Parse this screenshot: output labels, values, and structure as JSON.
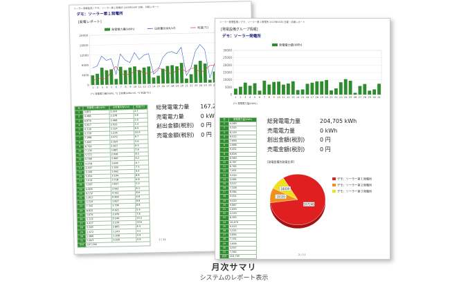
{
  "back": {
    "header_small": "ソーラー発電監視 / デモ：ソーラー第１発電所 2019年04月 日報・月報レポート",
    "title": "デモ：ソーラー第１発電所",
    "report_label": "[発電レポート]",
    "legend": [
      "発電電力量(kWh)",
      "日射量(kWh/㎡)",
      "気温(℃)"
    ],
    "axis_note": "(*1 発電電力量(kWh), *2 日射量(kWh/㎡), *3 気温(℃))",
    "table_headers": [
      "日",
      "発電電力量(kWh)",
      "日射量(kWh/㎡)",
      "気温(℃)"
    ],
    "rows": [
      [
        "1",
        "3,857",
        "2.059",
        "2.7"
      ],
      [
        "2",
        "4,488",
        "2.278",
        "3.8"
      ],
      [
        "3",
        "6,876",
        "3.468",
        "3.9"
      ],
      [
        "4",
        "5,817",
        "2.932",
        "3.4"
      ],
      [
        "5",
        "6,126",
        "3.124",
        "8.4"
      ],
      [
        "6",
        "2,239",
        "1.236",
        "10.9"
      ],
      [
        "7",
        "7,088",
        "3.672",
        "6.7"
      ],
      [
        "8",
        "5,665",
        "2.924",
        "5.6"
      ],
      [
        "9",
        "6,720",
        "2.615",
        "6.4"
      ],
      [
        "10",
        "7,136",
        "3.805",
        "7.6"
      ],
      [
        "11",
        "5,572",
        "2.958",
        "8.5"
      ],
      [
        "12",
        "6,586",
        "3.460",
        "6.2"
      ],
      [
        "13",
        "6,958",
        "3.648",
        "6.7"
      ],
      [
        "14",
        "2,497",
        "1.169",
        "7.3"
      ],
      [
        "15",
        "3,166",
        "1.662",
        "9.4"
      ],
      [
        "16",
        "5,954",
        "3.104",
        "8.8"
      ],
      [
        "17",
        "7,014",
        "3.718",
        "6.8"
      ],
      [
        "18",
        "7,297",
        "3.837",
        "5.5"
      ],
      [
        "19",
        "6,805",
        "3.562",
        "8.3"
      ],
      [
        "20",
        "8,132",
        "4.332",
        "8.6"
      ],
      [
        "21",
        "1,812",
        "0.906",
        "6.8"
      ],
      [
        "22",
        "3,510",
        "1.827",
        "8.8"
      ],
      [
        "23",
        "7,342",
        "3.796",
        "8.8"
      ],
      [
        "24",
        "8,832",
        "4.621",
        "5.9"
      ],
      [
        "25",
        "7,679",
        "3.976",
        "7.8"
      ],
      [
        "26",
        "1,112",
        "0.544",
        "10.2"
      ],
      [
        "27",
        "4,417",
        "2.234",
        "10.6"
      ],
      [
        "28",
        "5,605",
        "2.865",
        "6.4"
      ],
      [
        "29",
        "2,672",
        "1.249",
        "4.4"
      ],
      [
        "30",
        "2,866",
        "1.398",
        "5.9"
      ],
      [
        "31",
        "5,843",
        "3.026",
        "4.9"
      ]
    ],
    "total_label": "合計",
    "total_value": "167,246",
    "summary": [
      {
        "label": "総発電電力量",
        "value": "167,2"
      },
      {
        "label": "売電電力量",
        "value": "0 kWh"
      },
      {
        "label": "創出金額(税別)",
        "value": "0 円"
      },
      {
        "label": "売電金額(税別)",
        "value": "0 円"
      }
    ],
    "page_no": "2 / 11"
  },
  "front": {
    "header_small": "ソーラー発電監視 / デモ：ソーラー第１発電所 2019年04月 日報・月報レポート",
    "group_title": "[発電設備グループ情報]",
    "title": "デモ：ソーラー発電所",
    "legend": [
      "発電電力量(kWh)"
    ],
    "axis_note": "(*1 発電電力量(kWh))",
    "table_headers": [
      "日",
      "発電電力量(kWh)"
    ],
    "rows": [
      [
        "1",
        "4,060"
      ],
      [
        "2",
        "5,315"
      ],
      [
        "3",
        "8,129"
      ],
      [
        "4",
        "6,012"
      ],
      [
        "5",
        "7,699"
      ],
      [
        "6",
        "2,666"
      ],
      [
        "7",
        "9,451"
      ],
      [
        "8",
        "6,826"
      ],
      [
        "9",
        "8,560"
      ],
      [
        "10",
        "8,787"
      ],
      [
        "11",
        "6,762"
      ],
      [
        "12",
        "7,491"
      ],
      [
        "13",
        "9,029"
      ],
      [
        "14",
        "3,084"
      ],
      [
        "15",
        "3,517"
      ],
      [
        "16",
        "7,328"
      ],
      [
        "17",
        "8,084"
      ],
      [
        "18",
        "9,001"
      ],
      [
        "19",
        "9,020"
      ],
      [
        "20",
        "9,887"
      ],
      [
        "21",
        "2,839"
      ],
      [
        "22",
        "4,229"
      ],
      [
        "23",
        "8,355"
      ],
      [
        "24",
        "10,479"
      ],
      [
        "25",
        "9,413"
      ],
      [
        "26",
        "1,221"
      ],
      [
        "27",
        "5,854"
      ],
      [
        "28",
        "7,191"
      ],
      [
        "29",
        "2,658"
      ],
      [
        "30",
        "3,557"
      ],
      [
        "31",
        "7,362"
      ]
    ],
    "total_label": "合計",
    "total_value": "204,705",
    "summary": [
      {
        "label": "総発電電力量",
        "value": "204,705 kWh"
      },
      {
        "label": "売電電力量",
        "value": "0 kWh"
      },
      {
        "label": "創出金額(税別)",
        "value": "0 円"
      },
      {
        "label": "売電金額(税別)",
        "value": "0 円"
      }
    ],
    "pie_title": "[発電設備別発電比率]",
    "pie_legend": [
      "デモ：ソーラー第１発電所",
      "デモ：ソーラー第２発電所",
      "デモ：ソーラー第３発電所"
    ],
    "page_no": "2 / 11"
  },
  "caption": {
    "title": "月次サマリ",
    "subtitle": "システムのレポート表示"
  },
  "colors": {
    "bar": "#2e8b2e",
    "irradiance": "#3060c0",
    "temperature": "#e04040",
    "pie": [
      "#e02020",
      "#f0901a",
      "#f0e020"
    ]
  },
  "chart_data": [
    {
      "type": "bar",
      "series": [
        {
          "name": "発電電力量(kWh)",
          "values": [
            3857,
            4488,
            6876,
            5817,
            6126,
            2239,
            7088,
            5665,
            6720,
            7136,
            5572,
            6586,
            6958,
            2497,
            3166,
            5954,
            7014,
            7297,
            6805,
            8132,
            1812,
            3510,
            7342,
            8832,
            7679,
            1112,
            4417,
            5605,
            2672,
            2866,
            5843
          ]
        },
        {
          "name": "日射量(kWh/㎡)",
          "values": [
            2.059,
            2.278,
            3.468,
            2.932,
            3.124,
            1.236,
            3.672,
            2.924,
            2.615,
            3.805,
            2.958,
            3.46,
            3.648,
            1.169,
            1.662,
            3.104,
            3.718,
            3.837,
            3.562,
            4.332,
            0.906,
            1.827,
            3.796,
            4.621,
            3.976,
            0.544,
            2.234,
            2.865,
            1.249,
            1.398,
            3.026
          ]
        },
        {
          "name": "気温(℃)",
          "values": [
            2.7,
            3.8,
            3.9,
            3.4,
            8.4,
            10.9,
            6.7,
            5.6,
            6.4,
            7.6,
            8.5,
            6.2,
            6.7,
            7.3,
            9.4,
            8.8,
            6.8,
            5.5,
            8.3,
            8.6,
            6.8,
            8.8,
            8.8,
            5.9,
            7.8,
            10.2,
            10.6,
            6.4,
            4.4,
            5.9,
            4.9
          ]
        }
      ],
      "categories": [
        "1",
        "2",
        "3",
        "4",
        "5",
        "6",
        "7",
        "8",
        "9",
        "10",
        "11",
        "12",
        "13",
        "14",
        "15",
        "16",
        "17",
        "18",
        "19",
        "20",
        "21",
        "22",
        "23",
        "24",
        "25",
        "26",
        "27",
        "28",
        "29",
        "30",
        "31"
      ],
      "yticks": [
        "0",
        "4000",
        "8000",
        "12000",
        "16000",
        "20000"
      ],
      "ylim": [
        0,
        20000
      ]
    },
    {
      "type": "bar",
      "series": [
        {
          "name": "発電電力量(kWh)",
          "values": [
            4060,
            5315,
            8129,
            6012,
            7699,
            2666,
            9451,
            6826,
            8560,
            8787,
            6762,
            7491,
            9029,
            3084,
            3517,
            7328,
            8084,
            9001,
            9020,
            9887,
            2839,
            4229,
            8355,
            10479,
            9413,
            1221,
            5854,
            7191,
            2658,
            3557,
            7362
          ]
        }
      ],
      "categories": [
        "1",
        "2",
        "3",
        "4",
        "5",
        "6",
        "7",
        "8",
        "9",
        "10",
        "11",
        "12",
        "13",
        "14",
        "15",
        "16",
        "17",
        "18",
        "19",
        "20",
        "21",
        "22",
        "23",
        "24",
        "25",
        "26",
        "27",
        "28",
        "29",
        "30",
        "31"
      ],
      "yticks": [
        "0",
        "5000",
        "10000",
        "15000",
        "20000",
        "25000",
        "30000"
      ],
      "ylim": [
        0,
        30000
      ]
    },
    {
      "type": "pie",
      "labels": [
        "デモ：ソーラー第１発電所",
        "デモ：ソーラー第２発電所",
        "デモ：ソーラー第３発電所"
      ],
      "values": [
        167246,
        19330,
        18039
      ]
    }
  ]
}
